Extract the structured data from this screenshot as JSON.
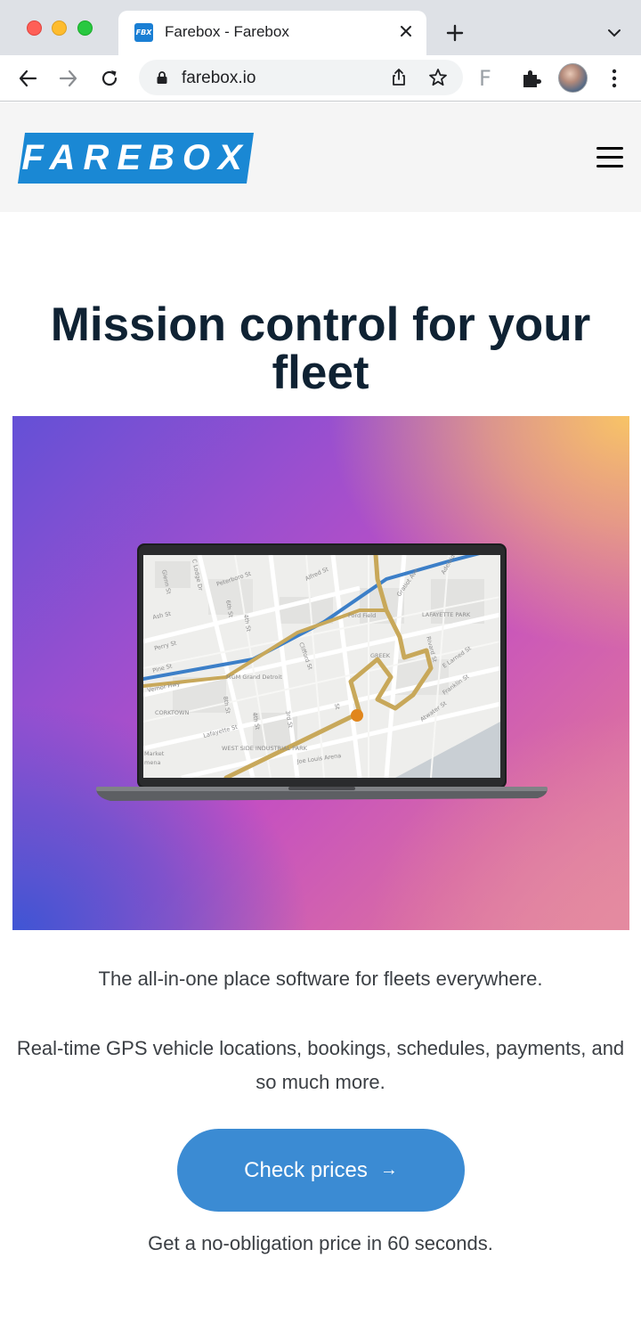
{
  "browser": {
    "tab": {
      "favicon_text": "FBX",
      "title": "Farebox - Farebox"
    },
    "url": "farebox.io",
    "extension_letter": "F",
    "icons": {
      "back": "arrow-left-icon",
      "forward": "arrow-right-icon",
      "reload": "reload-icon",
      "lock": "lock-icon",
      "share": "share-icon",
      "bookmark": "star-icon",
      "extensions": "puzzle-icon",
      "menu": "kebab-menu-icon"
    }
  },
  "site": {
    "logo_text": "FAREBOX",
    "brand_color": "#1a88d4",
    "menu_icon": "hamburger-icon"
  },
  "hero": {
    "title": "Mission control for your fleet",
    "tagline": "The all-in-one place software for fleets everywhere.",
    "description": "Real-time GPS vehicle locations, bookings, schedules, payments, and so much more.",
    "cta_label": "Check prices",
    "cta_arrow": "→",
    "cta_color": "#3b8bd3",
    "cta_note": "Get a no-obligation price in 60 seconds."
  },
  "map": {
    "labels": {
      "glenn": "Glenn St",
      "lodge": "C Lodge Dr",
      "peterboro": "Peterboro St",
      "alfred": "Alfred St",
      "gratiot": "Gratiot Ave",
      "adelaide": "Adelaide St",
      "fordfield": "Ford Field",
      "lafayette": "LAFAYETTE PARK",
      "ash": "Ash St",
      "perry": "Perry St",
      "pine": "Pine St",
      "mgm": "MGM Grand Detroit",
      "clifford": "Clifford St",
      "rivard": "Rivard St",
      "elarned": "E Larned St",
      "franklin": "Franklin St",
      "atwater": "Atwater St",
      "corktown": "CORKTOWN",
      "lafayette2": "Lafayette St",
      "westside": "WEST SIDE INDUSTRIAL PARK",
      "joelouis": "Joe Louis Arena",
      "market": "Market",
      "plena": "mena",
      "vernor": "Vernor Hwy",
      "sixth": "6th St",
      "fourth": "4th St",
      "third": "3rd St",
      "greektown": "GREEK",
      "fifth": "5th St",
      "fourth2": "4th St",
      "eighth": "8th St",
      "brush": "St"
    }
  }
}
